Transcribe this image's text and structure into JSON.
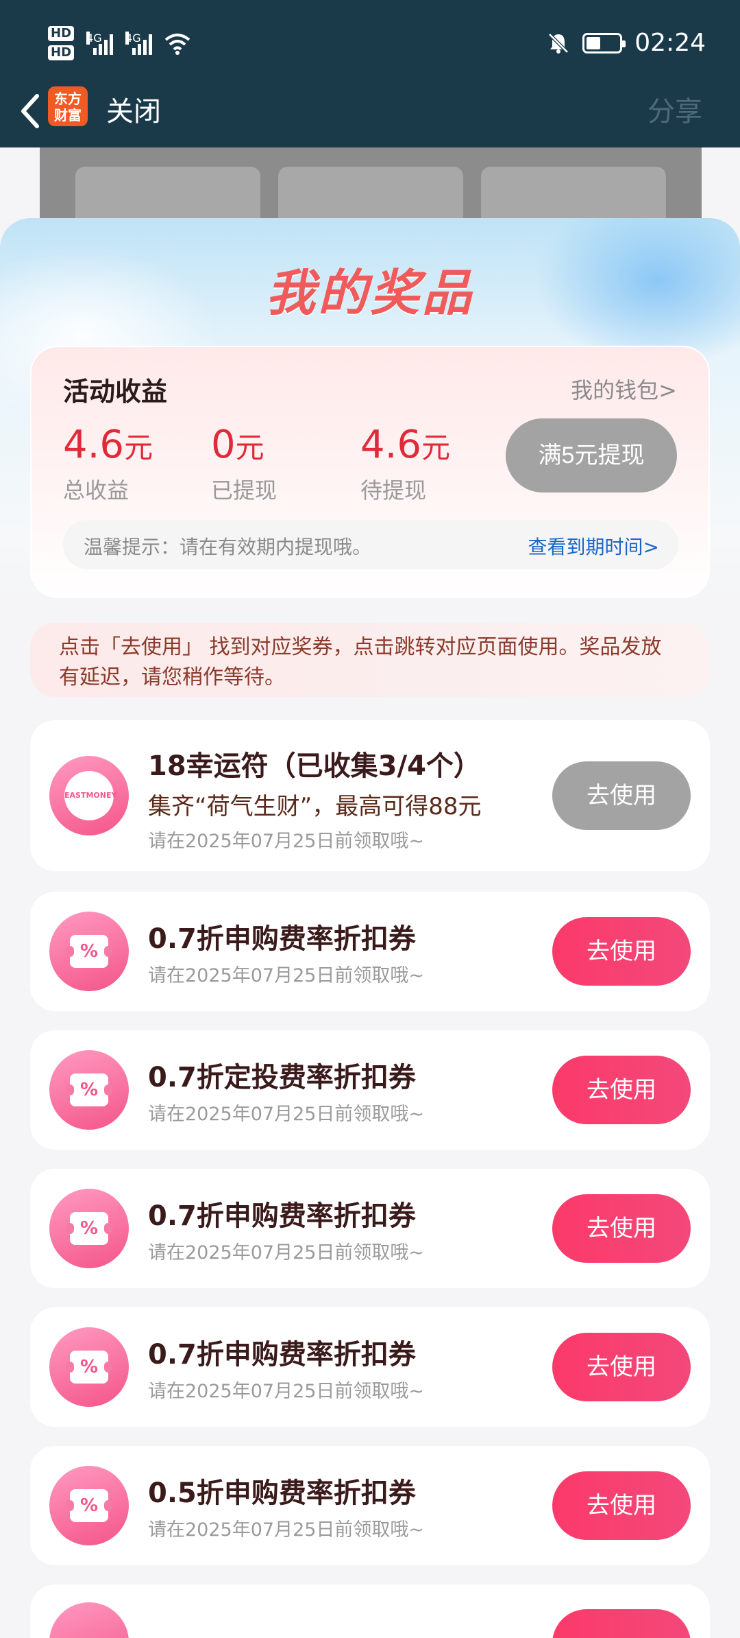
{
  "status": {
    "hd1": "HD",
    "hd2": "HD",
    "net1": "4G",
    "net2": "4G",
    "time": "02:24"
  },
  "nav": {
    "logo_line1": "东方",
    "logo_line2": "财富",
    "close_label": "关闭",
    "share_label": "分享"
  },
  "sheet": {
    "title": "我的奖品"
  },
  "earnings": {
    "heading": "活动收益",
    "wallet_link": "我的钱包>",
    "total_value": "4.6",
    "total_unit": "元",
    "total_label": "总收益",
    "withdrawn_value": "0",
    "withdrawn_unit": "元",
    "withdrawn_label": "已提现",
    "pending_value": "4.6",
    "pending_unit": "元",
    "pending_label": "待提现",
    "withdraw_button": "满5元提现",
    "tip_text": "温馨提示：请在有效期内提现哦。",
    "tip_link": "查看到期时间>"
  },
  "notice": {
    "text": "点击「去使用」 找到对应奖券，点击跳转对应页面使用。奖品发放有延迟，请您稍作等待。"
  },
  "coupons": [
    {
      "title": "18幸运符（已收集3/4个）",
      "subtitle": "集齐“荷气生财”，最高可得88元",
      "date": "请在2025年07月25日前领取哦~",
      "button": "去使用",
      "badge": "EASTMONEY"
    },
    {
      "title": "0.7折申购费率折扣券",
      "date": "请在2025年07月25日前领取哦~",
      "button": "去使用",
      "icon": "%"
    },
    {
      "title": "0.7折定投费率折扣券",
      "date": "请在2025年07月25日前领取哦~",
      "button": "去使用",
      "icon": "%"
    },
    {
      "title": "0.7折申购费率折扣券",
      "date": "请在2025年07月25日前领取哦~",
      "button": "去使用",
      "icon": "%"
    },
    {
      "title": "0.7折申购费率折扣券",
      "date": "请在2025年07月25日前领取哦~",
      "button": "去使用",
      "icon": "%"
    },
    {
      "title": "0.5折申购费率折扣券",
      "date": "请在2025年07月25日前领取哦~",
      "button": "去使用",
      "icon": "%"
    }
  ],
  "colors": {
    "header_bg": "#1a3a4a",
    "accent_red": "#e02a3a",
    "button_pink": "#fb3a6a",
    "button_gray": "#a3a3a3",
    "link_blue": "#1a66c8"
  },
  "icons": {
    "back": "chevron-left-icon",
    "mute": "bell-off-icon",
    "battery": "battery-icon",
    "wifi": "wifi-icon",
    "signal": "signal-icon",
    "coupon": "ticket-percent-icon"
  }
}
